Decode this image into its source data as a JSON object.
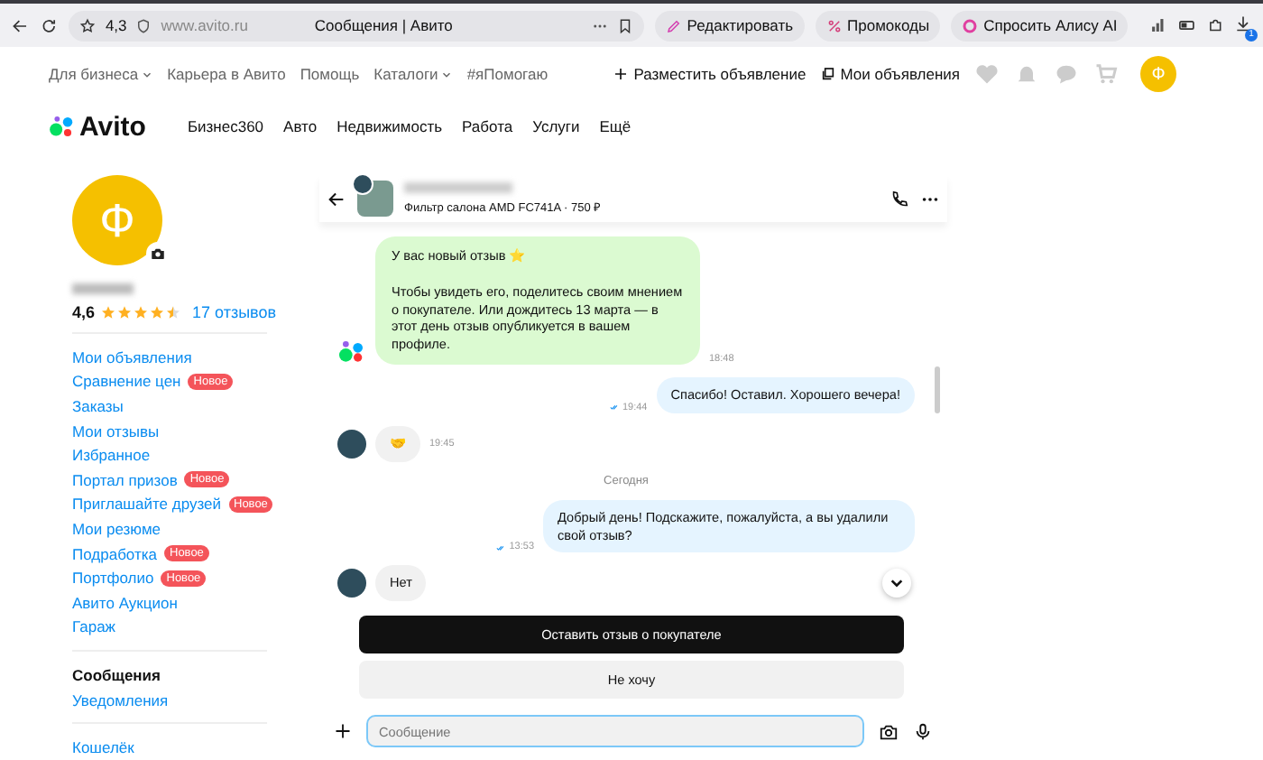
{
  "browser": {
    "rating": "4,3",
    "url": "www.avito.ru",
    "title": "Сообщения | Авито",
    "actions": [
      {
        "label": "Редактировать",
        "kind": "edit"
      },
      {
        "label": "Промокоды",
        "kind": "promo"
      },
      {
        "label": "Спросить Алису AI",
        "kind": "alice"
      }
    ],
    "download_badge": "1"
  },
  "top_nav": {
    "links": [
      {
        "label": "Для бизнеса",
        "dropdown": true
      },
      {
        "label": "Карьера в Авито",
        "dropdown": false
      },
      {
        "label": "Помощь",
        "dropdown": false
      },
      {
        "label": "Каталоги",
        "dropdown": true
      },
      {
        "label": "#яПомогаю",
        "dropdown": false
      }
    ],
    "post_ad": "Разместить объявление",
    "my_ads": "Мои объявления",
    "avatar_letter": "Ф"
  },
  "logo": "Avito",
  "categories": [
    "Бизнес360",
    "Авто",
    "Недвижимость",
    "Работа",
    "Услуги",
    "Ещё"
  ],
  "profile": {
    "avatar_letter": "Ф",
    "rating": "4,6",
    "stars": 4.5,
    "reviews": "17 отзывов",
    "groups": [
      [
        {
          "label": "Мои объявления",
          "selected": false
        },
        {
          "label": "Сравнение цен",
          "badge": "Новое",
          "selected": false
        },
        {
          "label": "Заказы",
          "selected": false
        },
        {
          "label": "Мои отзывы",
          "selected": false
        },
        {
          "label": "Избранное",
          "selected": false
        },
        {
          "label": "Портал призов",
          "badge": "Новое",
          "selected": false
        },
        {
          "label": "Приглашайте друзей",
          "badge": "Новое",
          "selected": false
        },
        {
          "label": "Мои резюме",
          "selected": false
        },
        {
          "label": "Подработка",
          "badge": "Новое",
          "selected": false
        },
        {
          "label": "Портфолио",
          "badge": "Новое",
          "selected": false
        },
        {
          "label": "Авито Аукцион",
          "selected": false
        },
        {
          "label": "Гараж",
          "selected": false
        }
      ],
      [
        {
          "label": "Сообщения",
          "selected": true
        },
        {
          "label": "Уведомления",
          "selected": false
        }
      ],
      [
        {
          "label": "Кошелёк",
          "selected": false
        }
      ]
    ]
  },
  "chat": {
    "item": "Фильтр салона AMD FC741A · 750 ₽",
    "messages": [
      {
        "kind": "system",
        "title": "У вас новый отзыв ⭐",
        "text": "Чтобы увидеть его, поделитесь своим мнением о покупателе. Или дождитесь 13 марта — в этот день отзыв опубликуется в вашем профиле.",
        "time": "18:48"
      },
      {
        "kind": "out",
        "text": "Спасибо! Оставил. Хорошего вечера!",
        "time": "19:44",
        "read": true
      },
      {
        "kind": "in",
        "text": "🤝",
        "time": "19:45"
      },
      {
        "kind": "date",
        "text": "Сегодня"
      },
      {
        "kind": "out",
        "text": "Добрый день! Подскажите, пожалуйста, а вы удалили свой отзыв?",
        "time": "13:53",
        "read": true
      },
      {
        "kind": "in",
        "text": "Нет"
      }
    ],
    "actions": [
      {
        "label": "Оставить отзыв о покупателе",
        "primary": true
      },
      {
        "label": "Не хочу",
        "primary": false
      }
    ],
    "input_placeholder": "Сообщение"
  }
}
